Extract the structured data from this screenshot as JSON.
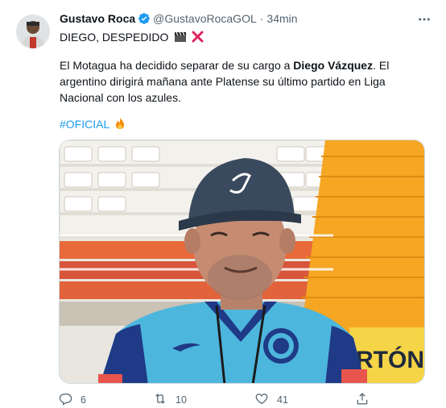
{
  "tweet": {
    "author_name": "Gustavo Roca",
    "handle": "@GustavoRocaGOL",
    "separator": "·",
    "time": "34min",
    "more_label": "•••",
    "headline": "DIEGO, DESPEDIDO",
    "body_pre": "El Motagua ha decidido separar de su cargo a ",
    "body_bold": "Diego Vázquez",
    "body_post": ". El argentino dirigirá mañana ante Platense su último partido en Liga Nacional con los azules.",
    "hashtag": "#OFICIAL",
    "stadium_text": "RTÓN",
    "actions": {
      "replies": "6",
      "retweets": "10",
      "likes": "41"
    }
  },
  "colors": {
    "link": "#1d9bf0",
    "secondary": "#536471",
    "cap": "#3a4a5e",
    "jersey": "#4db6dd",
    "seats_orange": "#f5a623"
  },
  "icons": [
    "verified-badge-icon",
    "clapper-icon",
    "cross-mark-icon",
    "fire-icon",
    "more-icon",
    "reply-icon",
    "retweet-icon",
    "like-icon",
    "share-icon"
  ]
}
